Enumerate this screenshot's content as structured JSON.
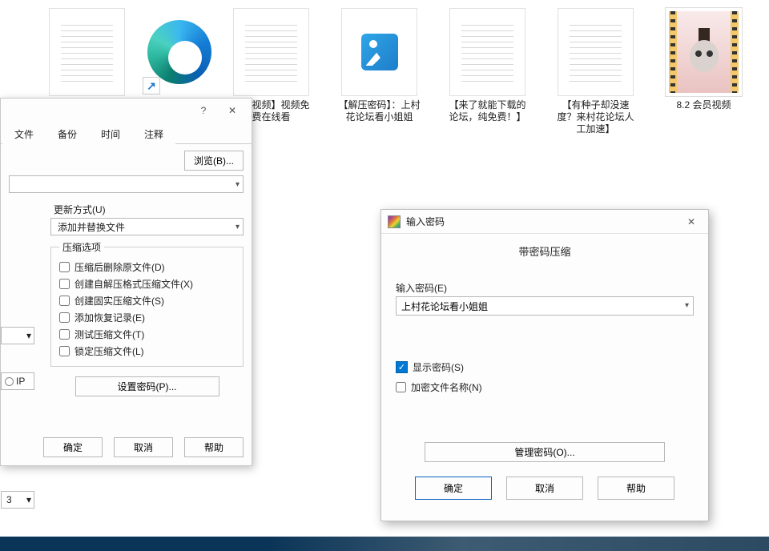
{
  "desktop": {
    "files": [
      {
        "label": ""
      },
      {
        "label": ""
      },
      {
        "label": "村花视频】视频免费在线看"
      },
      {
        "label": "【解压密码】：上村花论坛看小姐姐"
      },
      {
        "label": "【来了就能下载的论坛，纯免费！】"
      },
      {
        "label": "【有种子却没速度？来村花论坛人工加速】"
      },
      {
        "label": "8.2 会员视频"
      }
    ]
  },
  "dialog1": {
    "help_tooltip": "?",
    "tabs": [
      "文件",
      "备份",
      "时间",
      "注释"
    ],
    "browse_btn": "浏览(B)...",
    "update_section": "更新方式(U)",
    "update_value": "添加并替换文件",
    "left_zip": "IP",
    "left_combo2": "3",
    "options_legend": "压缩选项",
    "options": [
      "压缩后删除原文件(D)",
      "创建自解压格式压缩文件(X)",
      "创建固实压缩文件(S)",
      "添加恢复记录(E)",
      "测试压缩文件(T)",
      "锁定压缩文件(L)"
    ],
    "set_pwd_btn": "设置密码(P)...",
    "ok": "确定",
    "cancel": "取消",
    "help": "帮助"
  },
  "dialog2": {
    "title": "输入密码",
    "heading": "带密码压缩",
    "input_label": "输入密码(E)",
    "input_value": "上村花论坛看小姐姐",
    "show_pwd": "显示密码(S)",
    "encrypt_names": "加密文件名称(N)",
    "manage_btn": "管理密码(O)...",
    "ok": "确定",
    "cancel": "取消",
    "help": "帮助"
  }
}
